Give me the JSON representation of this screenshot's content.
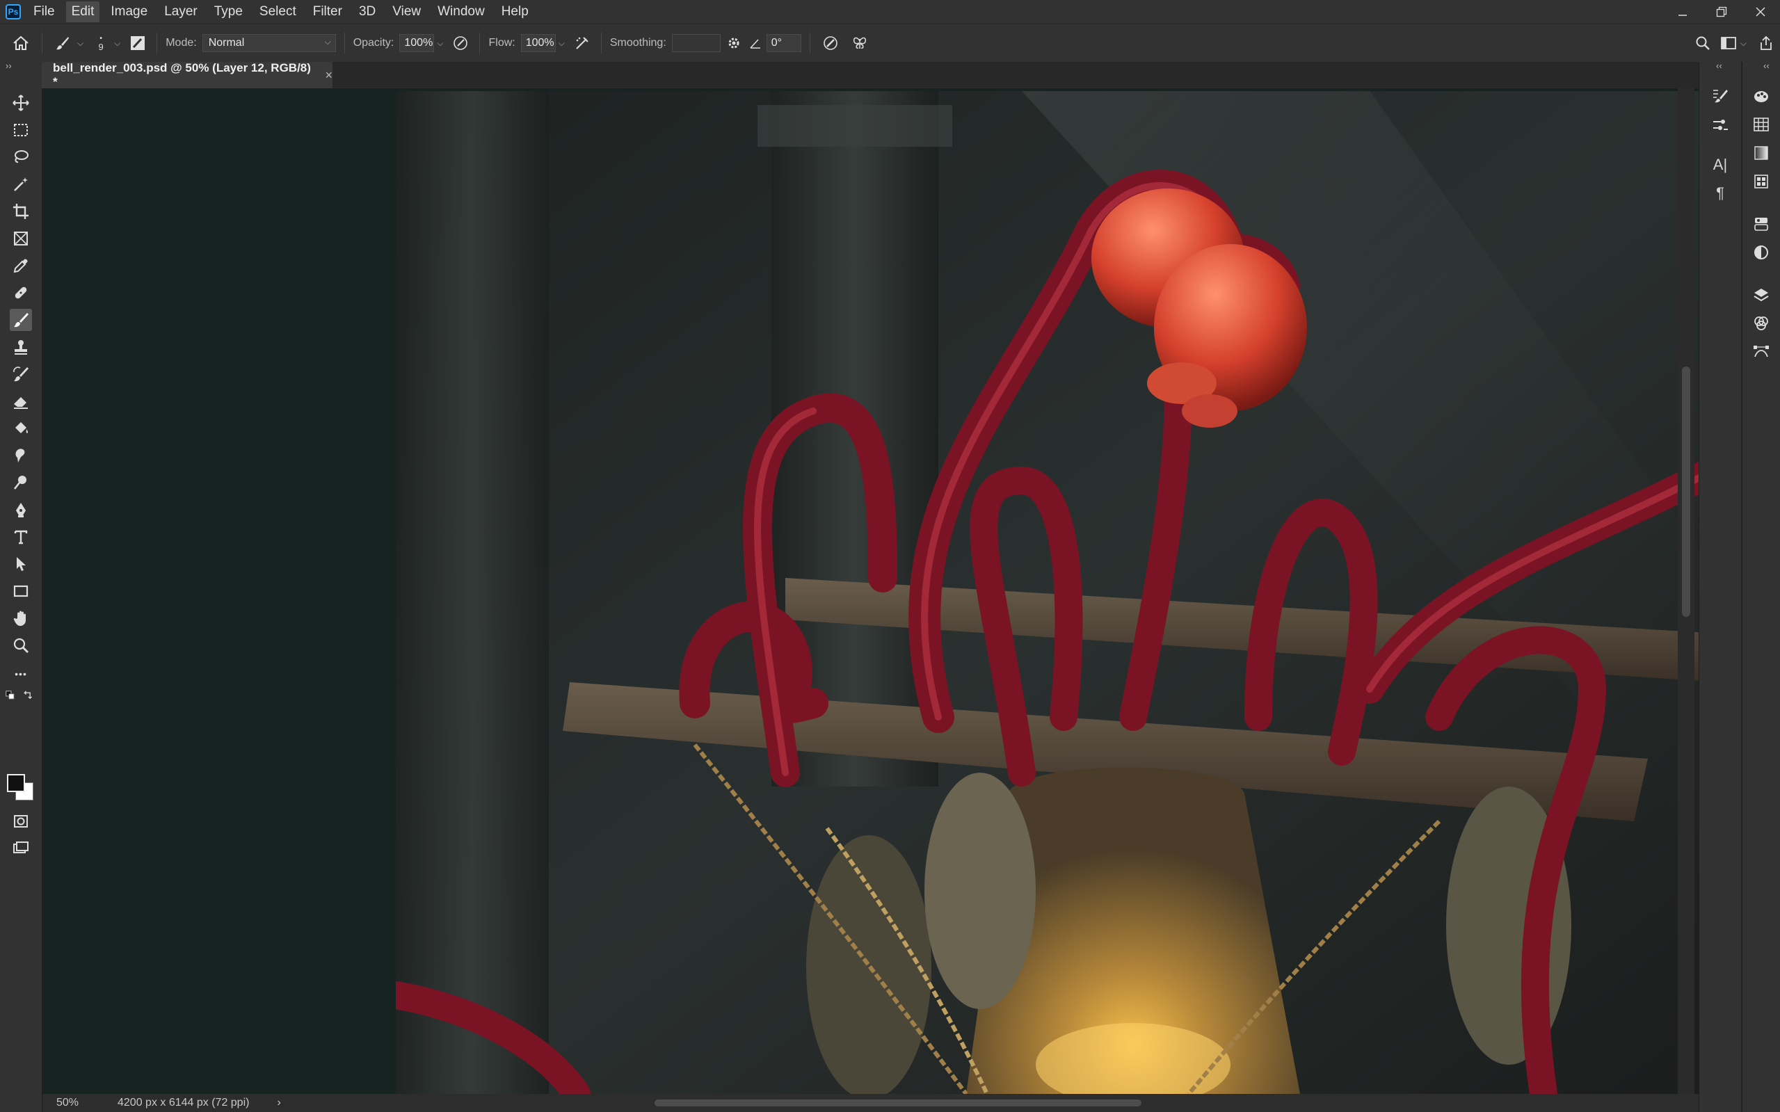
{
  "app": {
    "logo_text": "Ps"
  },
  "menu": {
    "items": [
      "File",
      "Edit",
      "Image",
      "Layer",
      "Type",
      "Select",
      "Filter",
      "3D",
      "View",
      "Window",
      "Help"
    ],
    "active": "Edit"
  },
  "options": {
    "brush_size": "9",
    "mode_label": "Mode:",
    "mode_value": "Normal",
    "opacity_label": "Opacity:",
    "opacity_value": "100%",
    "flow_label": "Flow:",
    "flow_value": "100%",
    "smoothing_label": "Smoothing:",
    "smoothing_value": "",
    "angle_value": "0°"
  },
  "document": {
    "tab_title": "bell_render_003.psd @ 50% (Layer 12, RGB/8) *",
    "close_glyph": "×"
  },
  "status": {
    "zoom": "50%",
    "doc_info": "4200 px x 6144 px (72 ppi)",
    "arrow": "›"
  },
  "toolbar": {
    "more_glyph": "•••"
  },
  "panels": {
    "character_glyph": "A|",
    "paragraph_glyph": "¶"
  },
  "colors": {
    "accent": "#31a8ff",
    "foreground_swatch": "#111111",
    "background_swatch": "#ffffff"
  }
}
